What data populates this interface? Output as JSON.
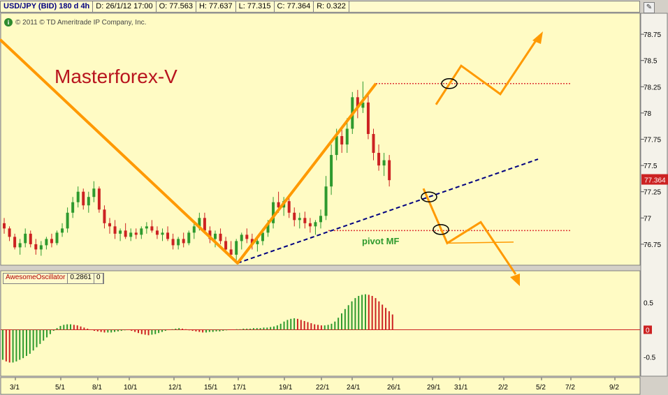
{
  "header": {
    "symbol": "USD/JPY (BID) 180 d 4h",
    "datetime": "D: 26/1/12 17:00",
    "open": "O: 77.563",
    "high": "H: 77.637",
    "low": "L: 77.315",
    "close": "C: 77.364",
    "range": "R: 0.322"
  },
  "copyright": "© 2011 © TD Ameritrade IP Company, Inc.",
  "indicator": {
    "name": "AwesomeOscillator",
    "value": "0.2861",
    "extra": "0"
  },
  "colors": {
    "background": "#fffbc4",
    "zigzag": "#ff9900",
    "up": "#2e9a2e",
    "down": "#cc2222",
    "trend": "#000080",
    "pivot": "#dd3333"
  },
  "chart_data": [
    {
      "type": "candlestick",
      "title": "Masterforex-V",
      "annotation": "pivot MF",
      "price_label": "77.364",
      "y_ticks": [
        76.75,
        77,
        77.25,
        77.5,
        77.75,
        78,
        78.25,
        78.5,
        78.75
      ],
      "y_tick_labels": [
        "76.75",
        "77",
        "77.25",
        "77.5",
        "77.75",
        "78",
        "78.25",
        "78.5",
        "78.75"
      ],
      "ylim": [
        76.55,
        78.95
      ],
      "x_tick_labels": [
        "3/1",
        "5/1",
        "8/1",
        "10/1",
        "12/1",
        "15/1",
        "17/1",
        "19/1",
        "22/1",
        "24/1",
        "26/1",
        "29/1",
        "31/1",
        "2/2",
        "5/2",
        "7/2",
        "9/2"
      ],
      "resistance_level": 78.28,
      "pivot_level": 76.88,
      "series": [
        {
          "kind": "ohlc_bars",
          "values": [
            [
              76.95,
              77.0,
              76.85,
              76.9
            ],
            [
              76.9,
              76.92,
              76.78,
              76.82
            ],
            [
              76.82,
              76.85,
              76.7,
              76.72
            ],
            [
              76.72,
              76.8,
              76.65,
              76.76
            ],
            [
              76.76,
              76.9,
              76.72,
              76.85
            ],
            [
              76.85,
              76.88,
              76.72,
              76.75
            ],
            [
              76.75,
              76.8,
              76.65,
              76.7
            ],
            [
              76.7,
              76.78,
              76.64,
              76.74
            ],
            [
              76.74,
              76.82,
              76.7,
              76.8
            ],
            [
              76.8,
              76.85,
              76.72,
              76.76
            ],
            [
              76.76,
              76.88,
              76.74,
              76.86
            ],
            [
              76.86,
              76.95,
              76.82,
              76.9
            ],
            [
              76.9,
              77.1,
              76.86,
              77.05
            ],
            [
              77.05,
              77.2,
              77.0,
              77.15
            ],
            [
              77.15,
              77.3,
              77.1,
              77.25
            ],
            [
              77.25,
              77.28,
              77.08,
              77.12
            ],
            [
              77.12,
              77.25,
              77.05,
              77.2
            ],
            [
              77.2,
              77.35,
              77.15,
              77.28
            ],
            [
              77.28,
              77.3,
              77.05,
              77.08
            ],
            [
              77.08,
              77.12,
              76.9,
              76.95
            ],
            [
              76.95,
              77.0,
              76.85,
              76.92
            ],
            [
              76.92,
              76.98,
              76.8,
              76.85
            ],
            [
              76.85,
              76.9,
              76.78,
              76.88
            ],
            [
              76.88,
              76.95,
              76.8,
              76.82
            ],
            [
              76.82,
              76.9,
              76.78,
              76.86
            ],
            [
              76.86,
              76.9,
              76.8,
              76.84
            ],
            [
              76.84,
              76.92,
              76.8,
              76.9
            ],
            [
              76.9,
              76.96,
              76.85,
              76.92
            ],
            [
              76.92,
              76.98,
              76.86,
              76.88
            ],
            [
              76.88,
              76.92,
              76.8,
              76.84
            ],
            [
              76.84,
              76.9,
              76.78,
              76.86
            ],
            [
              76.86,
              76.92,
              76.78,
              76.8
            ],
            [
              76.8,
              76.85,
              76.7,
              76.74
            ],
            [
              76.74,
              76.82,
              76.7,
              76.8
            ],
            [
              76.8,
              76.86,
              76.72,
              76.76
            ],
            [
              76.76,
              76.88,
              76.74,
              76.86
            ],
            [
              76.86,
              76.96,
              76.8,
              76.92
            ],
            [
              76.92,
              77.05,
              76.88,
              77.0
            ],
            [
              77.0,
              77.05,
              76.85,
              76.88
            ],
            [
              76.88,
              76.92,
              76.76,
              76.8
            ],
            [
              76.8,
              76.88,
              76.72,
              76.85
            ],
            [
              76.85,
              76.9,
              76.75,
              76.78
            ],
            [
              76.78,
              76.82,
              76.66,
              76.7
            ],
            [
              76.7,
              76.78,
              76.62,
              76.65
            ],
            [
              76.65,
              76.8,
              76.6,
              76.78
            ],
            [
              76.78,
              76.86,
              76.7,
              76.84
            ],
            [
              76.84,
              76.9,
              76.76,
              76.8
            ],
            [
              76.8,
              76.85,
              76.7,
              76.75
            ],
            [
              76.75,
              76.82,
              76.68,
              76.78
            ],
            [
              76.78,
              76.9,
              76.74,
              76.86
            ],
            [
              76.86,
              76.98,
              76.82,
              76.95
            ],
            [
              76.95,
              77.2,
              76.9,
              77.15
            ],
            [
              77.15,
              77.25,
              77.05,
              77.1
            ],
            [
              77.1,
              77.2,
              77.02,
              77.16
            ],
            [
              77.16,
              77.22,
              77.0,
              77.05
            ],
            [
              77.05,
              77.1,
              76.92,
              76.98
            ],
            [
              76.98,
              77.05,
              76.9,
              77.0
            ],
            [
              77.0,
              77.06,
              76.9,
              76.95
            ],
            [
              76.95,
              77.0,
              76.86,
              76.92
            ],
            [
              76.92,
              76.98,
              76.84,
              76.96
            ],
            [
              76.96,
              77.08,
              76.9,
              77.02
            ],
            [
              77.02,
              77.4,
              76.98,
              77.3
            ],
            [
              77.3,
              77.7,
              77.22,
              77.6
            ],
            [
              77.6,
              77.85,
              77.55,
              77.78
            ],
            [
              77.78,
              77.84,
              77.62,
              77.7
            ],
            [
              77.7,
              77.95,
              77.62,
              77.85
            ],
            [
              77.85,
              78.2,
              77.8,
              78.15
            ],
            [
              78.15,
              78.22,
              77.95,
              78.05
            ],
            [
              78.05,
              78.3,
              78.0,
              78.1
            ],
            [
              78.1,
              78.18,
              77.75,
              77.8
            ],
            [
              77.8,
              77.85,
              77.55,
              77.62
            ],
            [
              77.62,
              77.7,
              77.45,
              77.5
            ],
            [
              77.5,
              77.62,
              77.4,
              77.55
            ],
            [
              77.55,
              77.6,
              77.3,
              77.36
            ]
          ]
        }
      ]
    },
    {
      "type": "bar",
      "title": "AwesomeOscillator",
      "y_tick_labels": [
        "0.5",
        "0",
        "-0.5"
      ],
      "ylim": [
        -0.85,
        0.85
      ],
      "zero_marker": "0",
      "series": [
        {
          "kind": "histogram",
          "values": [
            -0.55,
            -0.58,
            -0.6,
            -0.6,
            -0.58,
            -0.55,
            -0.52,
            -0.48,
            -0.44,
            -0.38,
            -0.32,
            -0.26,
            -0.2,
            -0.14,
            -0.08,
            -0.02,
            0.03,
            0.07,
            0.09,
            0.1,
            0.1,
            0.09,
            0.08,
            0.06,
            0.04,
            0.02,
            0.0,
            -0.02,
            -0.03,
            -0.04,
            -0.05,
            -0.05,
            -0.05,
            -0.04,
            -0.03,
            -0.02,
            -0.01,
            0.0,
            -0.02,
            -0.04,
            -0.06,
            -0.08,
            -0.09,
            -0.1,
            -0.09,
            -0.08,
            -0.06,
            -0.04,
            -0.02,
            0.0,
            0.01,
            0.02,
            0.03,
            0.02,
            0.01,
            -0.01,
            -0.02,
            -0.03,
            -0.04,
            -0.05,
            -0.05,
            -0.04,
            -0.04,
            -0.03,
            -0.03,
            -0.02,
            -0.01,
            0.0,
            0.0,
            0.01,
            0.01,
            0.02,
            0.02,
            0.02,
            0.03,
            0.03,
            0.03,
            0.04,
            0.04,
            0.05,
            0.06,
            0.08,
            0.11,
            0.15,
            0.18,
            0.2,
            0.21,
            0.2,
            0.18,
            0.16,
            0.14,
            0.12,
            0.1,
            0.09,
            0.08,
            0.08,
            0.09,
            0.11,
            0.15,
            0.22,
            0.3,
            0.38,
            0.45,
            0.52,
            0.58,
            0.62,
            0.64,
            0.65,
            0.64,
            0.62,
            0.58,
            0.52,
            0.46,
            0.4,
            0.34,
            0.28
          ]
        }
      ]
    }
  ]
}
